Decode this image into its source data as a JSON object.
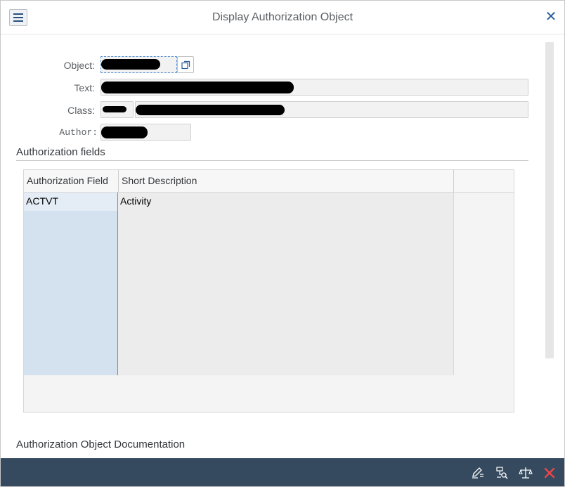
{
  "dialog": {
    "title": "Display Authorization Object"
  },
  "form": {
    "object_label": "Object:",
    "text_label": "Text:",
    "class_label": "Class:",
    "author_label": "Author:"
  },
  "auth_fields": {
    "section_title": "Authorization fields",
    "columns": [
      "Authorization Field",
      "Short Description"
    ],
    "rows": [
      {
        "field": "ACTVT",
        "description": "Activity"
      },
      {
        "field": "",
        "description": ""
      },
      {
        "field": "",
        "description": ""
      },
      {
        "field": "",
        "description": ""
      },
      {
        "field": "",
        "description": ""
      },
      {
        "field": "",
        "description": ""
      },
      {
        "field": "",
        "description": ""
      },
      {
        "field": "",
        "description": ""
      },
      {
        "field": "",
        "description": ""
      },
      {
        "field": "",
        "description": ""
      }
    ]
  },
  "documentation": {
    "section_title": "Authorization Object Documentation"
  },
  "footer": {
    "icons": [
      "edit-icon",
      "where-used-icon",
      "compare-icon",
      "cancel-icon"
    ]
  },
  "colors": {
    "footer_bg": "#354a5f",
    "accent": "#2a5d99",
    "cancel_red": "#e8474a"
  }
}
